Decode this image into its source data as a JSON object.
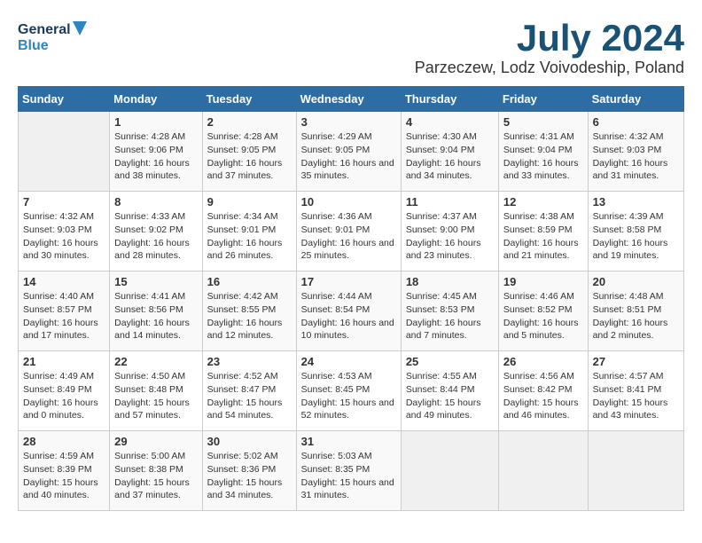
{
  "logo": {
    "line1": "General",
    "line2": "Blue"
  },
  "title": "July 2024",
  "location": "Parzeczew, Lodz Voivodeship, Poland",
  "weekdays": [
    "Sunday",
    "Monday",
    "Tuesday",
    "Wednesday",
    "Thursday",
    "Friday",
    "Saturday"
  ],
  "weeks": [
    [
      {
        "day": "",
        "empty": true
      },
      {
        "day": "1",
        "sunrise": "Sunrise: 4:28 AM",
        "sunset": "Sunset: 9:06 PM",
        "daylight": "Daylight: 16 hours and 38 minutes."
      },
      {
        "day": "2",
        "sunrise": "Sunrise: 4:28 AM",
        "sunset": "Sunset: 9:05 PM",
        "daylight": "Daylight: 16 hours and 37 minutes."
      },
      {
        "day": "3",
        "sunrise": "Sunrise: 4:29 AM",
        "sunset": "Sunset: 9:05 PM",
        "daylight": "Daylight: 16 hours and 35 minutes."
      },
      {
        "day": "4",
        "sunrise": "Sunrise: 4:30 AM",
        "sunset": "Sunset: 9:04 PM",
        "daylight": "Daylight: 16 hours and 34 minutes."
      },
      {
        "day": "5",
        "sunrise": "Sunrise: 4:31 AM",
        "sunset": "Sunset: 9:04 PM",
        "daylight": "Daylight: 16 hours and 33 minutes."
      },
      {
        "day": "6",
        "sunrise": "Sunrise: 4:32 AM",
        "sunset": "Sunset: 9:03 PM",
        "daylight": "Daylight: 16 hours and 31 minutes."
      }
    ],
    [
      {
        "day": "7",
        "sunrise": "Sunrise: 4:32 AM",
        "sunset": "Sunset: 9:03 PM",
        "daylight": "Daylight: 16 hours and 30 minutes."
      },
      {
        "day": "8",
        "sunrise": "Sunrise: 4:33 AM",
        "sunset": "Sunset: 9:02 PM",
        "daylight": "Daylight: 16 hours and 28 minutes."
      },
      {
        "day": "9",
        "sunrise": "Sunrise: 4:34 AM",
        "sunset": "Sunset: 9:01 PM",
        "daylight": "Daylight: 16 hours and 26 minutes."
      },
      {
        "day": "10",
        "sunrise": "Sunrise: 4:36 AM",
        "sunset": "Sunset: 9:01 PM",
        "daylight": "Daylight: 16 hours and 25 minutes."
      },
      {
        "day": "11",
        "sunrise": "Sunrise: 4:37 AM",
        "sunset": "Sunset: 9:00 PM",
        "daylight": "Daylight: 16 hours and 23 minutes."
      },
      {
        "day": "12",
        "sunrise": "Sunrise: 4:38 AM",
        "sunset": "Sunset: 8:59 PM",
        "daylight": "Daylight: 16 hours and 21 minutes."
      },
      {
        "day": "13",
        "sunrise": "Sunrise: 4:39 AM",
        "sunset": "Sunset: 8:58 PM",
        "daylight": "Daylight: 16 hours and 19 minutes."
      }
    ],
    [
      {
        "day": "14",
        "sunrise": "Sunrise: 4:40 AM",
        "sunset": "Sunset: 8:57 PM",
        "daylight": "Daylight: 16 hours and 17 minutes."
      },
      {
        "day": "15",
        "sunrise": "Sunrise: 4:41 AM",
        "sunset": "Sunset: 8:56 PM",
        "daylight": "Daylight: 16 hours and 14 minutes."
      },
      {
        "day": "16",
        "sunrise": "Sunrise: 4:42 AM",
        "sunset": "Sunset: 8:55 PM",
        "daylight": "Daylight: 16 hours and 12 minutes."
      },
      {
        "day": "17",
        "sunrise": "Sunrise: 4:44 AM",
        "sunset": "Sunset: 8:54 PM",
        "daylight": "Daylight: 16 hours and 10 minutes."
      },
      {
        "day": "18",
        "sunrise": "Sunrise: 4:45 AM",
        "sunset": "Sunset: 8:53 PM",
        "daylight": "Daylight: 16 hours and 7 minutes."
      },
      {
        "day": "19",
        "sunrise": "Sunrise: 4:46 AM",
        "sunset": "Sunset: 8:52 PM",
        "daylight": "Daylight: 16 hours and 5 minutes."
      },
      {
        "day": "20",
        "sunrise": "Sunrise: 4:48 AM",
        "sunset": "Sunset: 8:51 PM",
        "daylight": "Daylight: 16 hours and 2 minutes."
      }
    ],
    [
      {
        "day": "21",
        "sunrise": "Sunrise: 4:49 AM",
        "sunset": "Sunset: 8:49 PM",
        "daylight": "Daylight: 16 hours and 0 minutes."
      },
      {
        "day": "22",
        "sunrise": "Sunrise: 4:50 AM",
        "sunset": "Sunset: 8:48 PM",
        "daylight": "Daylight: 15 hours and 57 minutes."
      },
      {
        "day": "23",
        "sunrise": "Sunrise: 4:52 AM",
        "sunset": "Sunset: 8:47 PM",
        "daylight": "Daylight: 15 hours and 54 minutes."
      },
      {
        "day": "24",
        "sunrise": "Sunrise: 4:53 AM",
        "sunset": "Sunset: 8:45 PM",
        "daylight": "Daylight: 15 hours and 52 minutes."
      },
      {
        "day": "25",
        "sunrise": "Sunrise: 4:55 AM",
        "sunset": "Sunset: 8:44 PM",
        "daylight": "Daylight: 15 hours and 49 minutes."
      },
      {
        "day": "26",
        "sunrise": "Sunrise: 4:56 AM",
        "sunset": "Sunset: 8:42 PM",
        "daylight": "Daylight: 15 hours and 46 minutes."
      },
      {
        "day": "27",
        "sunrise": "Sunrise: 4:57 AM",
        "sunset": "Sunset: 8:41 PM",
        "daylight": "Daylight: 15 hours and 43 minutes."
      }
    ],
    [
      {
        "day": "28",
        "sunrise": "Sunrise: 4:59 AM",
        "sunset": "Sunset: 8:39 PM",
        "daylight": "Daylight: 15 hours and 40 minutes."
      },
      {
        "day": "29",
        "sunrise": "Sunrise: 5:00 AM",
        "sunset": "Sunset: 8:38 PM",
        "daylight": "Daylight: 15 hours and 37 minutes."
      },
      {
        "day": "30",
        "sunrise": "Sunrise: 5:02 AM",
        "sunset": "Sunset: 8:36 PM",
        "daylight": "Daylight: 15 hours and 34 minutes."
      },
      {
        "day": "31",
        "sunrise": "Sunrise: 5:03 AM",
        "sunset": "Sunset: 8:35 PM",
        "daylight": "Daylight: 15 hours and 31 minutes."
      },
      {
        "day": "",
        "empty": true
      },
      {
        "day": "",
        "empty": true
      },
      {
        "day": "",
        "empty": true
      }
    ]
  ]
}
